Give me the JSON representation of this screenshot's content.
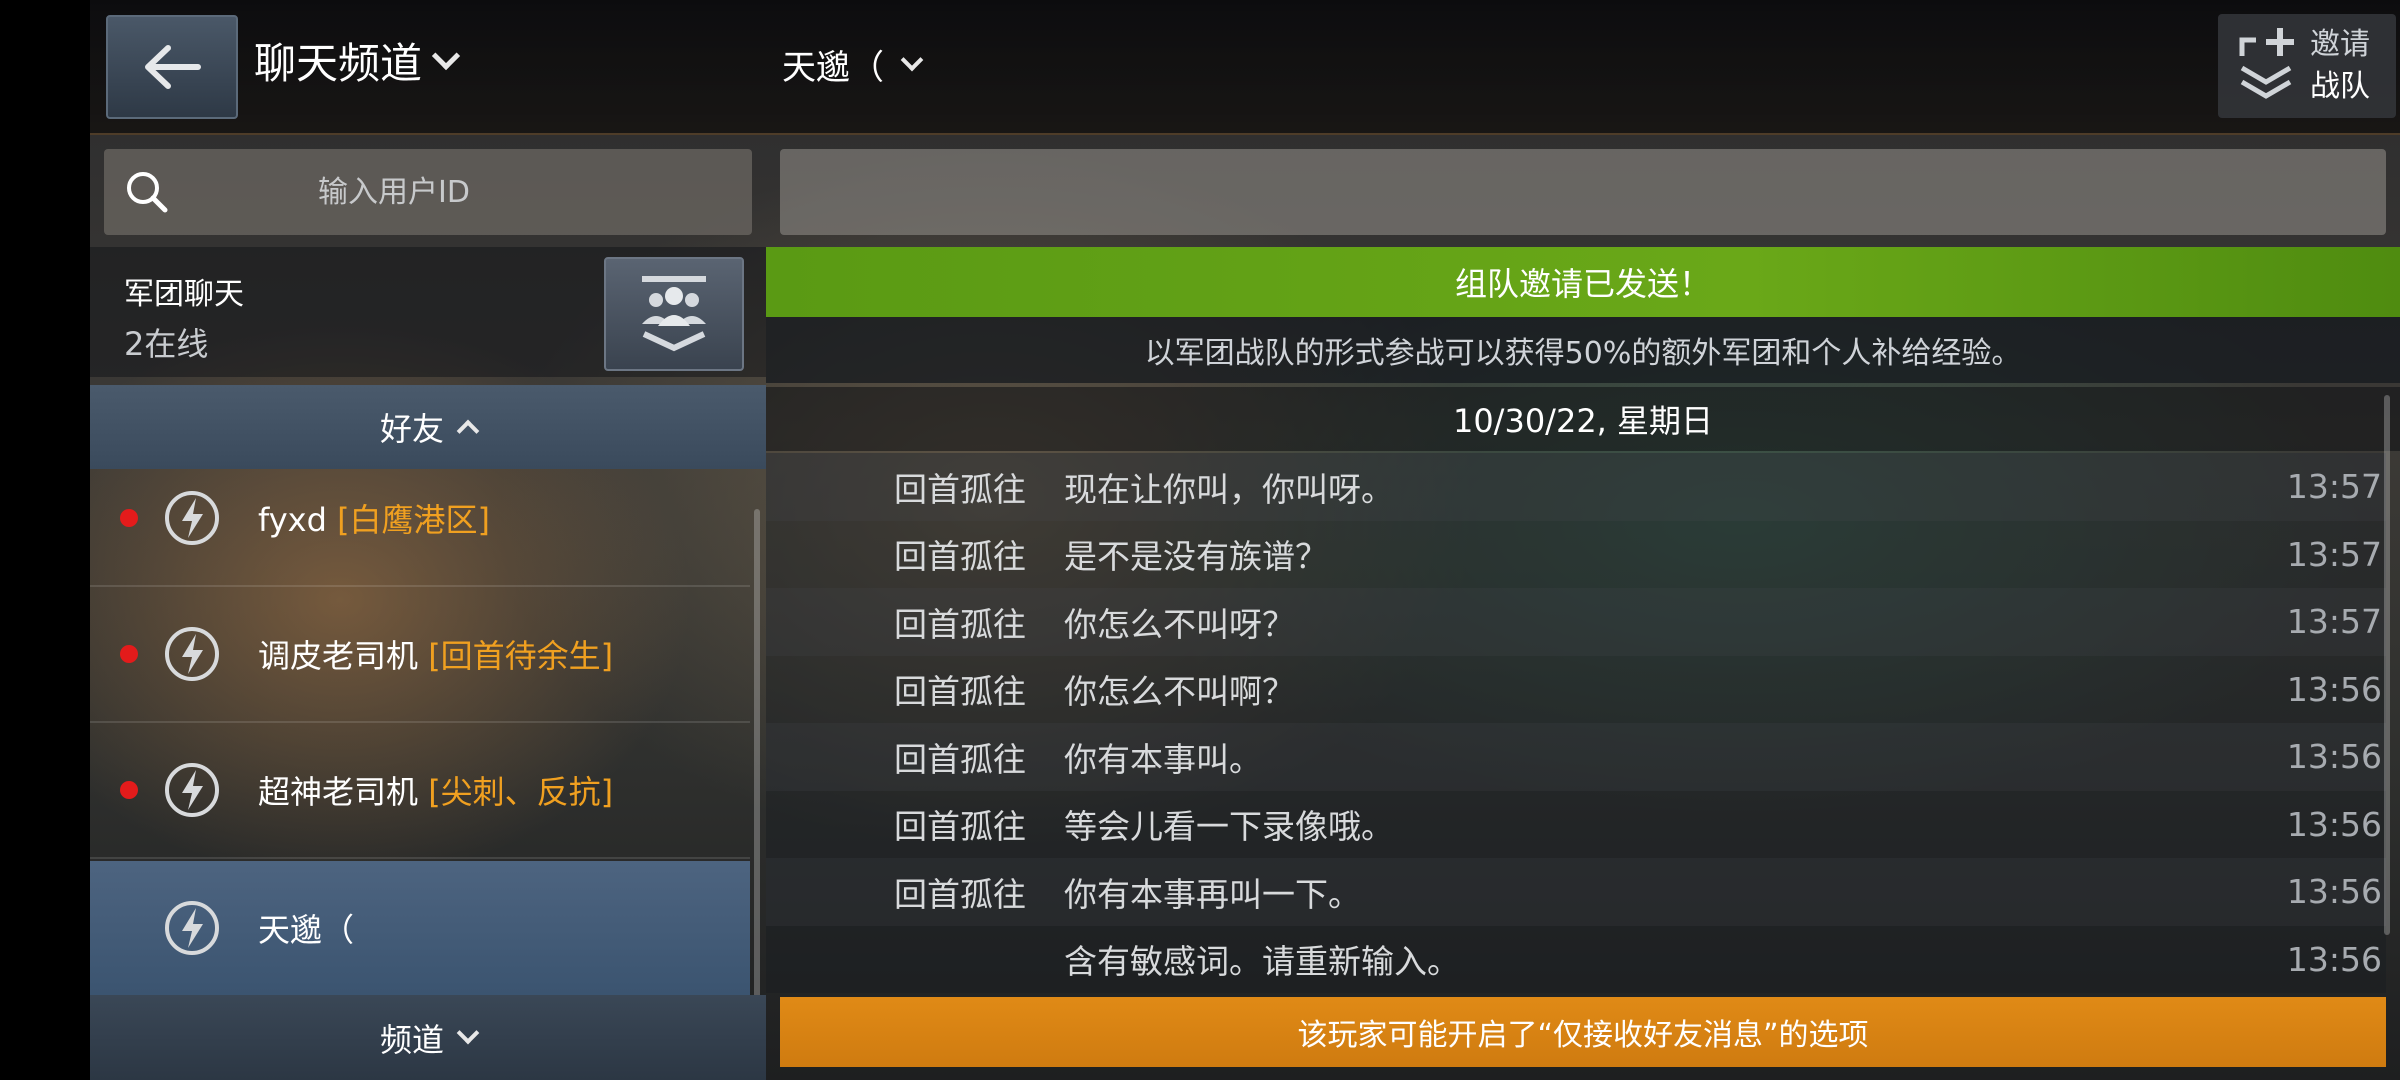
{
  "header": {
    "title": "聊天频道",
    "selected_contact": "天邈（",
    "invite_line1": "邀请",
    "invite_line2": "战队"
  },
  "search": {
    "placeholder": "输入用户ID"
  },
  "legion": {
    "title": "军团聊天",
    "online": "2在线"
  },
  "friends_section": {
    "label": "好友"
  },
  "friends": [
    {
      "name": "fyxd",
      "clan": "[白鹰港区]",
      "online": true
    },
    {
      "name": "调皮老司机",
      "clan": "[回首待余生]",
      "online": true
    },
    {
      "name": "超神老司机",
      "clan": "[尖刺、反抗]",
      "online": true
    },
    {
      "name": "天邈（",
      "clan": "",
      "online": false,
      "selected": true
    }
  ],
  "channel_section": {
    "label": "频道"
  },
  "chat": {
    "input_value": "",
    "success_banner": "组队邀请已发送！",
    "notice": "以军团战队的形式参战可以获得50%的额外军团和个人补给经验。",
    "date": "10/30/22, 星期日",
    "messages": [
      {
        "sender": "回首孤往",
        "text": "现在让你叫，你叫呀。",
        "time": "13:57"
      },
      {
        "sender": "回首孤往",
        "text": "是不是没有族谱？",
        "time": "13:57"
      },
      {
        "sender": "回首孤往",
        "text": "你怎么不叫呀？",
        "time": "13:57"
      },
      {
        "sender": "回首孤往",
        "text": "你怎么不叫啊？",
        "time": "13:56"
      },
      {
        "sender": "回首孤往",
        "text": "你有本事叫。",
        "time": "13:56"
      },
      {
        "sender": "回首孤往",
        "text": "等会儿看一下录像哦。",
        "time": "13:56"
      },
      {
        "sender": "回首孤往",
        "text": "你有本事再叫一下。",
        "time": "13:56"
      },
      {
        "sender": "",
        "text": "含有敏感词。请重新输入。",
        "time": "13:56"
      }
    ],
    "warning_banner": "该玩家可能开启了“仅接收好友消息”的选项"
  },
  "colors": {
    "success_green": "#6aa818",
    "warning_orange": "#e08a16",
    "clan_orange": "#f0a020",
    "online_red": "#e31b1b",
    "selected_blue": "#4d6480"
  }
}
